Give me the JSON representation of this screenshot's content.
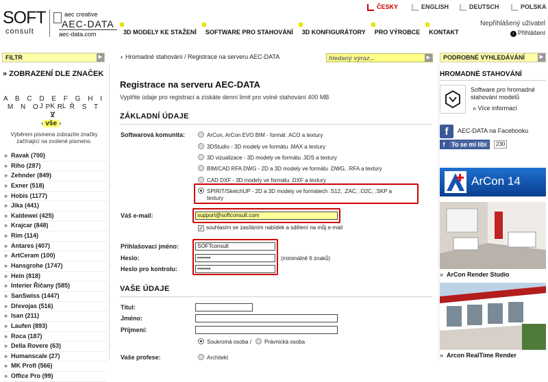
{
  "header": {
    "logo": {
      "soft": "SOFT",
      "consult": "consult",
      "tag": "aec creative",
      "aec": "AEC-DATA",
      "url": "aec-data.com"
    },
    "languages": [
      "ČESKY",
      "ENGLISH",
      "DEUTSCH",
      "POLSKA"
    ],
    "active_language": "ČESKY",
    "user_status": "Nepřihlášený uživatel",
    "login_label": "Přihlášení",
    "nav": [
      "3D MODELY KE STAŽENÍ",
      "SOFTWARE PRO STAHOVÁNÍ",
      "3D KONFIGURÁTORY",
      "PRO VÝROBCE",
      "KONTAKT"
    ]
  },
  "left": {
    "filter_label": "FILTR",
    "section_title": "ZOBRAZENÍ DLE ZNAČEK",
    "alphabet_rows": [
      "A B C D E F G H I J K L",
      "M N O P R Ř S T V",
      "Z"
    ],
    "all_label": "vše",
    "note": "Výběrem písmena zobrazíte značky začínající na zvolené písmeno.",
    "brands": [
      "Ravak (700)",
      "Riho (287)",
      "Zehnder (849)",
      "Exner (518)",
      "Hobis (1177)",
      "Jika (441)",
      "Kaldewei (425)",
      "Krajcar (848)",
      "Rim (114)",
      "Antares (407)",
      "ArtCeram (100)",
      "Hansgrohe (1747)",
      "Hein (818)",
      "Interier Říčany (585)",
      "SanSwiss (1447)",
      "Dřevojas (516)",
      "Isan (211)",
      "Laufen (893)",
      "Roca (187)",
      "Della Rovere (63)",
      "Humanscale (27)",
      "MK Profi (566)",
      "Office Pro (99)"
    ]
  },
  "main": {
    "breadcrumb": "Hromadné stahování / Registrace na serveru AEC-DATA",
    "search_placeholder": "hledaný výraz...",
    "title": "Registrace na serveru AEC-DATA",
    "subtitle": "Vyplňte údaje pro registraci a získáte denní limit pro volné stahování 400 MB",
    "section_basic": "ZÁKLADNÍ ÚDAJE",
    "software_label": "Softwarová komunita:",
    "software_options": [
      "ArCon, ArCon EVO BIM - formát .ACO a textury",
      "3DStudio - 3D modely ve formátu .MAX a textury",
      "3D vizualizace - 3D modely ve formátu .3DS a textury",
      "BIM/CAD RFA DWG - 2D a 3D modely ve formátu .DWG, .RFA a textury",
      "CAD DXF - 3D modely ve formátu .DXF a textury"
    ],
    "software_selected_line1": "SPIRIT/SketchUP - 2D a 3D modely ve formátech .S12, .ZAC, .O2C, .SKP a",
    "software_selected_line2": "textury",
    "email_label": "Váš e-mail:",
    "email_value": "support@softconsult.com",
    "consent_label": "souhlasím se zasíláním nabídek a sdělení na můj e-mail",
    "login_label": "Přihlašovací jméno:",
    "login_value": "SOFTconsult",
    "password_label": "Heslo:",
    "password_value": "•••••••",
    "password_hint": "(minimálně 6 znaků)",
    "password2_label": "Heslo pro kontrolu:",
    "password2_value": "•••••••",
    "section_personal": "VAŠE ÚDAJE",
    "title_label": "Titul:",
    "first_name_label": "Jméno:",
    "last_name_label": "Příjmení:",
    "person_private": "Soukromá osoba /",
    "person_legal": "Právnická osoba",
    "profession_label": "Vaše profese:",
    "profession_option": "Architekt"
  },
  "right": {
    "search_label": "PODROBNÉ VYHLEDÁVÁNÍ",
    "bulk_title": "HROMADNÉ STAHOVÁNÍ",
    "bulk_text": "Software pro hromadné stahování modelů",
    "more_info": "Více informací",
    "facebook_label": "AEC-DATA na Facebooku",
    "like_label": "To se mi líbí",
    "like_count": "230",
    "arcon_banner": "ArCon 14",
    "render_studio": "ArCon Render Studio",
    "realtime_render": "Arcon RealTime Render"
  },
  "colors": {
    "accent_yellow": "#ffff99",
    "highlight_red": "#d10000",
    "facebook_blue": "#3b5998",
    "active_lang": "#cc0000"
  }
}
